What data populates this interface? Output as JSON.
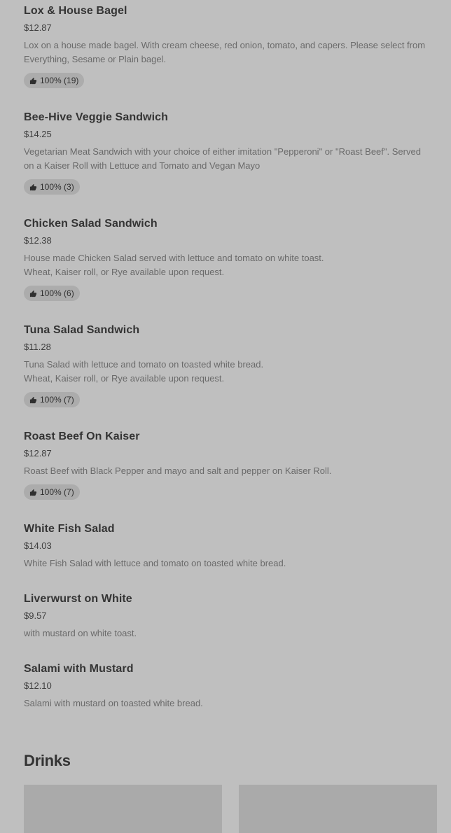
{
  "items": [
    {
      "name": "Lox & House Bagel",
      "price": "$12.87",
      "description": "Lox on a house made bagel. With cream cheese, red onion, tomato, and capers. Please select from Everything, Sesame or Plain bagel.",
      "rating": "100% (19)"
    },
    {
      "name": "Bee-Hive Veggie Sandwich",
      "price": "$14.25",
      "description": "Vegetarian Meat Sandwich with your choice of either imitation \"Pepperoni\" or \"Roast Beef\". Served on a Kaiser Roll with Lettuce and Tomato and Vegan Mayo",
      "rating": "100% (3)"
    },
    {
      "name": "Chicken Salad Sandwich",
      "price": "$12.38",
      "description": "House made Chicken Salad served with lettuce and tomato on white toast.\nWheat, Kaiser roll, or Rye available upon request.",
      "rating": "100% (6)"
    },
    {
      "name": "Tuna Salad Sandwich",
      "price": "$11.28",
      "description": "Tuna Salad with lettuce and tomato on toasted white bread.\nWheat, Kaiser roll, or Rye available upon request.",
      "rating": "100% (7)"
    },
    {
      "name": "Roast Beef On Kaiser",
      "price": "$12.87",
      "description": "Roast Beef with Black Pepper and mayo and salt and pepper on Kaiser Roll.",
      "rating": "100% (7)"
    },
    {
      "name": "White Fish Salad",
      "price": "$14.03",
      "description": "White Fish Salad with lettuce and tomato on toasted white bread."
    },
    {
      "name": "Liverwurst on White",
      "price": "$9.57",
      "description": "with mustard on white toast."
    },
    {
      "name": "Salami with Mustard",
      "price": "$12.10",
      "description": "Salami with mustard on toasted white bread."
    }
  ],
  "sections": {
    "drinks_title": "Drinks"
  },
  "icons": {
    "rating": "thumbs-up-icon"
  }
}
